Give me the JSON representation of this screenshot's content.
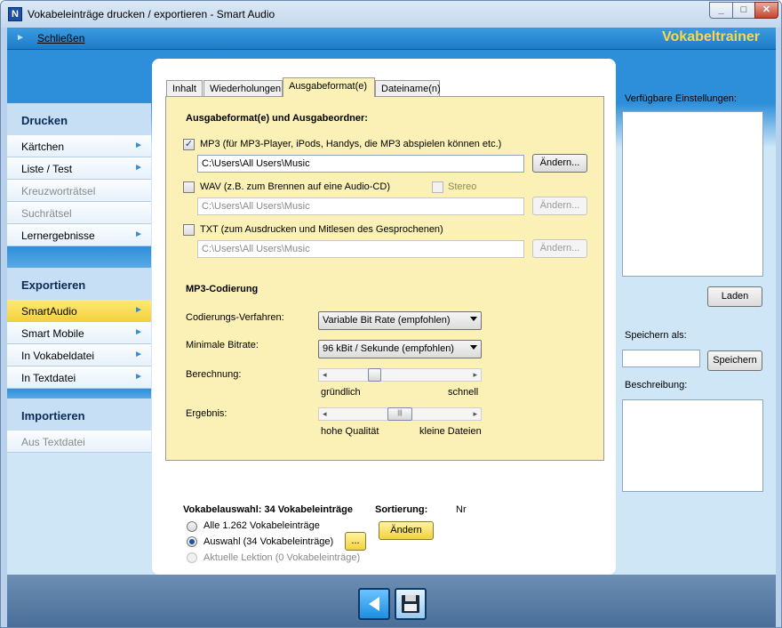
{
  "window": {
    "title": "Vokabeleinträge drucken / exportieren - Smart Audio",
    "app_icon": "N",
    "min": "_",
    "max": "□",
    "close": "✕"
  },
  "menubar": {
    "close_label": "Schließen",
    "brand": "Vokabeltrainer"
  },
  "sidebar": {
    "drucken_title": "Drucken",
    "drucken_items": [
      {
        "label": "Kärtchen",
        "enabled": true
      },
      {
        "label": "Liste / Test",
        "enabled": true
      },
      {
        "label": "Kreuzworträtsel",
        "enabled": false
      },
      {
        "label": "Suchrätsel",
        "enabled": false
      },
      {
        "label": "Lernergebnisse",
        "enabled": true
      }
    ],
    "export_title": "Exportieren",
    "export_items": [
      {
        "label": "SmartAudio",
        "selected": true
      },
      {
        "label": "Smart Mobile"
      },
      {
        "label": "In Vokabeldatei"
      },
      {
        "label": "In Textdatei"
      }
    ],
    "import_title": "Importieren",
    "import_items": [
      {
        "label": "Aus Textdatei",
        "enabled": false
      }
    ]
  },
  "tabs": [
    {
      "label": "Inhalt"
    },
    {
      "label": "Wiederholungen"
    },
    {
      "label": "Ausgabeformat(e)",
      "active": true
    },
    {
      "label": "Dateiname(n)"
    }
  ],
  "output": {
    "heading": "Ausgabeformat(e) und Ausgabeordner:",
    "mp3": {
      "label": "MP3 (für MP3-Player, iPods, Handys, die MP3 abspielen können etc.)",
      "checked": true,
      "path": "C:\\Users\\All Users\\Music",
      "button": "Ändern..."
    },
    "wav": {
      "label": "WAV (z.B. zum Brennen auf eine Audio-CD)",
      "checked": false,
      "stereo_label": "Stereo",
      "path": "C:\\Users\\All Users\\Music",
      "button": "Ändern..."
    },
    "txt": {
      "label": "TXT (zum Ausdrucken und Mitlesen des Gesprochenen)",
      "checked": false,
      "path": "C:\\Users\\All Users\\Music",
      "button": "Ändern..."
    }
  },
  "mp3coding": {
    "heading": "MP3-Codierung",
    "method_label": "Codierungs-Verfahren:",
    "method_value": "Variable Bit Rate (empfohlen)",
    "bitrate_label": "Minimale Bitrate:",
    "bitrate_value": "96 kBit / Sekunde (empfohlen)",
    "calc_label": "Berechnung:",
    "calc_low": "gründlich",
    "calc_high": "schnell",
    "calc_level": 0.3,
    "result_label": "Ergebnis:",
    "result_low": "hohe Qualität",
    "result_high": "kleine Dateien",
    "result_level": 0.5
  },
  "selection": {
    "heading": "Vokabelauswahl: 34 Vokabeleinträge",
    "options": [
      {
        "label": "Alle 1.262 Vokabeleinträge",
        "checked": false,
        "enabled": true
      },
      {
        "label": "Auswahl (34 Vokabeleinträge)",
        "checked": true,
        "enabled": true
      },
      {
        "label": "Aktuelle Lektion (0 Vokabeleinträge)",
        "checked": false,
        "enabled": false
      }
    ],
    "dots_button": "...",
    "sort_label": "Sortierung:",
    "sort_value": "Nr",
    "change_button": "Ändern"
  },
  "rightpanel": {
    "available_label": "Verfügbare Einstellungen:",
    "load_button": "Laden",
    "save_as_label": "Speichern als:",
    "save_as_value": "",
    "save_button": "Speichern",
    "description_label": "Beschreibung:"
  },
  "bottom": {
    "back_icon": "back-arrow-icon",
    "save_icon": "floppy-disk-icon"
  }
}
